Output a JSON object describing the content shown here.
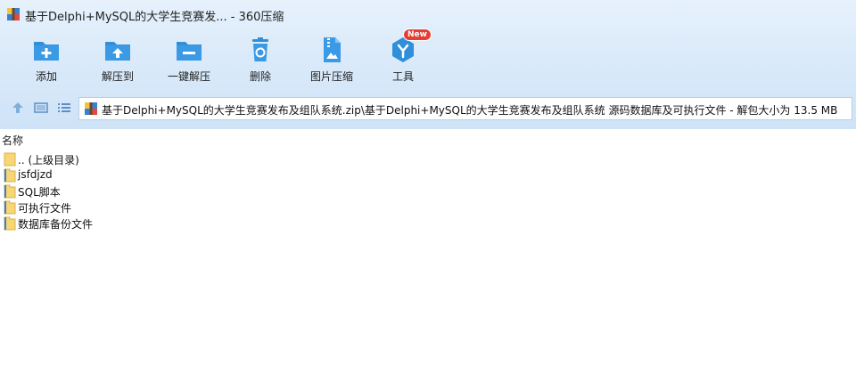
{
  "window": {
    "title": "基于Delphi+MySQL的大学生竞赛发...  - 360压缩"
  },
  "toolbar": {
    "items": [
      {
        "label": "添加",
        "icon": "add-icon"
      },
      {
        "label": "解压到",
        "icon": "extract-to-icon"
      },
      {
        "label": "一键解压",
        "icon": "one-click-extract-icon"
      },
      {
        "label": "删除",
        "icon": "delete-icon"
      },
      {
        "label": "图片压缩",
        "icon": "image-compress-icon"
      },
      {
        "label": "工具",
        "icon": "tools-icon",
        "badge": "New"
      }
    ]
  },
  "navigation": {
    "address": "基于Delphi+MySQL的大学生竞赛发布及组队系统.zip\\基于Delphi+MySQL的大学生竞赛发布及组队系统 源码数据库及可执行文件 - 解包大小为 13.5 MB"
  },
  "list": {
    "column_name": "名称",
    "items": [
      {
        "name": ".. (上级目录)"
      },
      {
        "name": "jsfdjzd"
      },
      {
        "name": "SQL脚本"
      },
      {
        "name": "可执行文件"
      },
      {
        "name": "数据库备份文件"
      }
    ]
  },
  "colors": {
    "accent": "#2f8fdb",
    "toolbar_bg": "#d7e8f9",
    "folder": "#f7d774",
    "badge": "#e63d35"
  }
}
